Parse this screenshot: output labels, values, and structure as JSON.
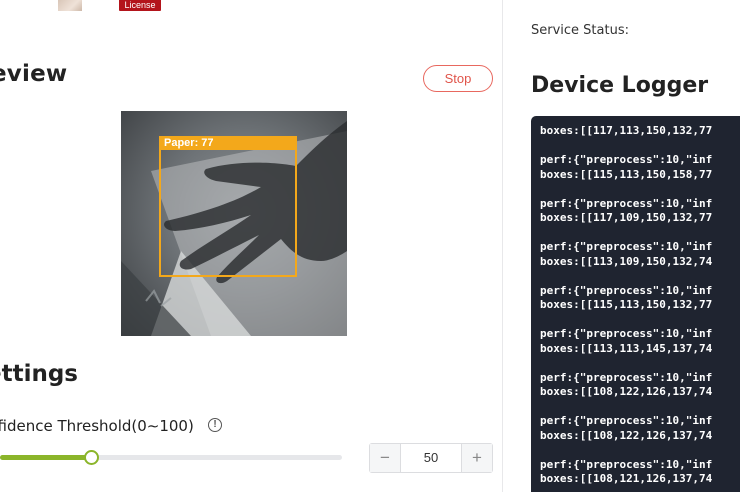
{
  "top": {
    "license_badge": "License"
  },
  "preview": {
    "title": "eview",
    "stop_label": "Stop",
    "detection_label": "Paper: 77"
  },
  "settings": {
    "title": "ettings",
    "confidence_label": "nfidence Threshold(0∼100)",
    "info_icon_glyph": "!",
    "threshold": 50,
    "threshold_display": "50",
    "threshold_min": 0,
    "threshold_max": 100,
    "minus_glyph": "−",
    "plus_glyph": "+"
  },
  "service": {
    "status_label": "Service Status:"
  },
  "logger": {
    "title": "Device Logger",
    "lines": [
      "boxes:[[117,113,150,132,77",
      "",
      "perf:{\"preprocess\":10,\"inf",
      "boxes:[[115,113,150,158,77",
      "",
      "perf:{\"preprocess\":10,\"inf",
      "boxes:[[117,109,150,132,77",
      "",
      "perf:{\"preprocess\":10,\"inf",
      "boxes:[[113,109,150,132,74",
      "",
      "perf:{\"preprocess\":10,\"inf",
      "boxes:[[115,113,150,132,77",
      "",
      "perf:{\"preprocess\":10,\"inf",
      "boxes:[[113,113,145,137,74",
      "",
      "perf:{\"preprocess\":10,\"inf",
      "boxes:[[108,122,126,137,74",
      "",
      "perf:{\"preprocess\":10,\"inf",
      "boxes:[[108,122,126,137,74",
      "",
      "perf:{\"preprocess\":10,\"inf",
      "boxes:[[108,121,126,137,74"
    ]
  },
  "colors": {
    "accent_green": "#8bb52a",
    "stop_red": "#e0554b",
    "license_red": "#b3141b",
    "detection_orange": "#f3a81b",
    "logger_bg": "#1f2430"
  }
}
